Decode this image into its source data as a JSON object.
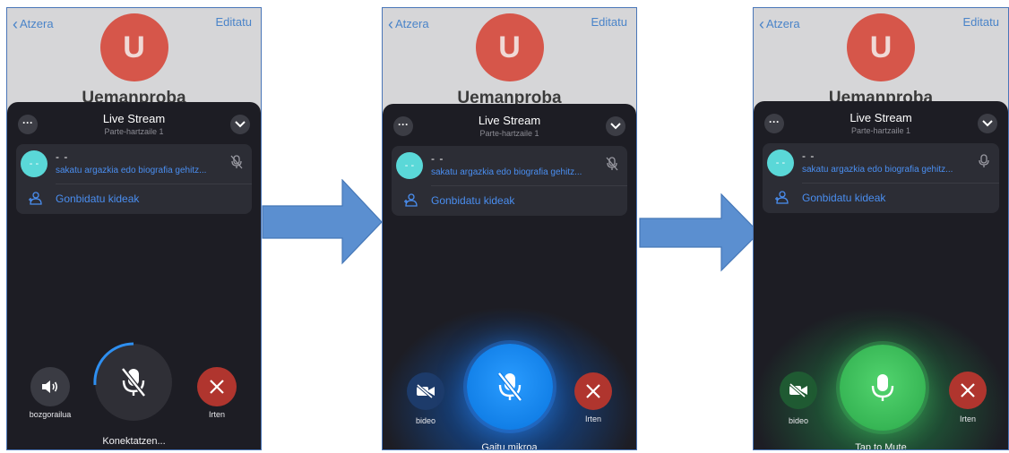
{
  "screens": [
    {
      "back": "Atzera",
      "edit": "Editatu",
      "avatar_letter": "U",
      "name": "Uemanproba",
      "title": "Live Stream",
      "subtitle": "Parte-hartzaile 1",
      "participant_name": "- -",
      "participant_sub": "sakatu argazkia edo biografia gehitz...",
      "participant_avatar": "- -",
      "invite": "Gonbidatu kideak",
      "left_label": "bozgorailua",
      "right_label": "Irten",
      "status": "Konektatzen..."
    },
    {
      "back": "Atzera",
      "edit": "Editatu",
      "avatar_letter": "U",
      "name": "Uemanproba",
      "title": "Live Stream",
      "subtitle": "Parte-hartzaile 1",
      "participant_name": "- -",
      "participant_sub": "sakatu argazkia edo biografia gehitz...",
      "participant_avatar": "- -",
      "invite": "Gonbidatu kideak",
      "left_label": "bideo",
      "right_label": "Irten",
      "status": "Gaitu mikroa"
    },
    {
      "back": "Atzera",
      "edit": "Editatu",
      "avatar_letter": "U",
      "name": "Uemanproba",
      "title": "Live Stream",
      "subtitle": "Parte-hartzaile 1",
      "participant_name": "- -",
      "participant_sub": "sakatu argazkia edo biografia gehitz...",
      "participant_avatar": "- -",
      "invite": "Gonbidatu kideak",
      "left_label": "bideo",
      "right_label": "Irten",
      "status": "Tap to Mute"
    }
  ],
  "colors": {
    "link": "#4a8ef0",
    "leave": "#b0352e",
    "mic_connecting": "#2f2f36",
    "mic_unmuted_blue": "#1e88f0",
    "mic_active_green": "#3dbd5e",
    "arrow": "#5b8fd0"
  }
}
